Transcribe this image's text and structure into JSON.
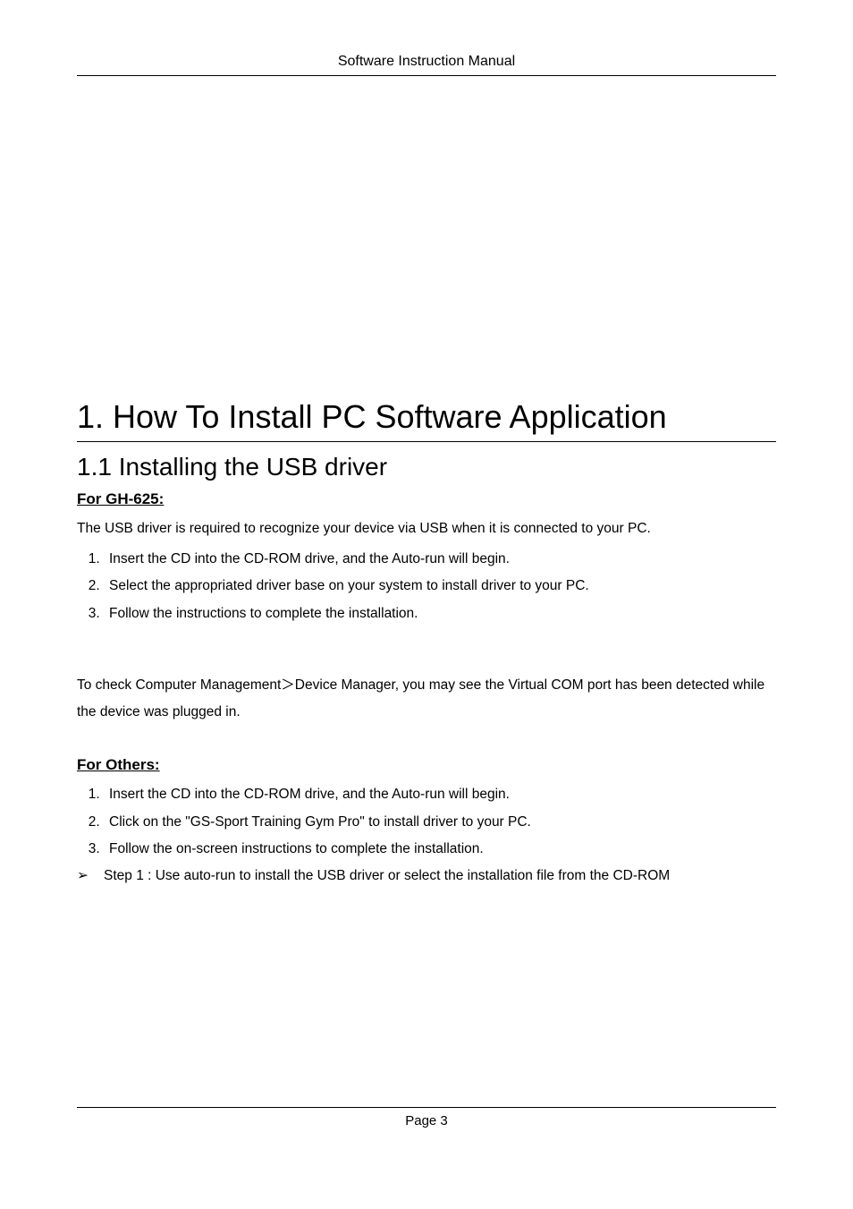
{
  "header": {
    "title": "Software Instruction Manual"
  },
  "h1": "1. How To Install PC Software Application",
  "h2": "1.1 Installing the USB driver",
  "section_a": {
    "subhead": "For GH-625:",
    "intro": "The USB driver is required to recognize your device via USB when it is connected to your PC.",
    "items": [
      "Insert the CD into the CD-ROM drive, and the Auto-run will begin.",
      "Select the appropriated driver base on your system to install driver to your PC.",
      "Follow the instructions to complete the installation."
    ],
    "post": "To check Computer Management＞Device Manager, you may see the Virtual COM port has been detected while the device was plugged in."
  },
  "section_b": {
    "subhead": "For Others:",
    "items": [
      "Insert the CD into the CD-ROM drive, and the Auto-run will begin.",
      "Click on the \"GS-Sport Training Gym Pro\" to install driver to your PC.",
      "Follow the on-screen instructions to complete the installation."
    ],
    "bullet_marker": "➢",
    "bullet_text": "Step 1 : Use auto-run to install the USB driver or select the installation file from the CD-ROM"
  },
  "footer": {
    "text": "Page 3"
  }
}
